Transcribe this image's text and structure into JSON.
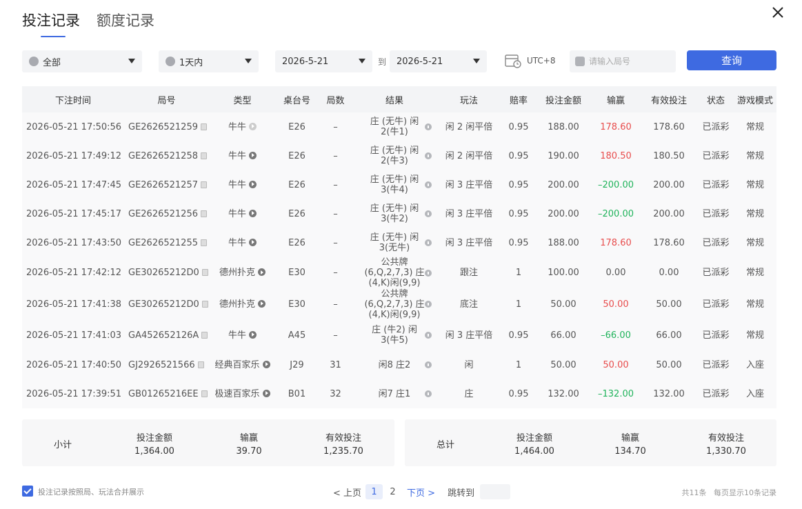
{
  "tabs": [
    {
      "label": "投注记录"
    },
    {
      "label": "额度记录"
    }
  ],
  "filters": {
    "category": "全部",
    "period": "1天内",
    "date_from": "2026-5-21",
    "to_label": "到",
    "date_to": "2026-5-21",
    "timezone": "UTC+8",
    "round_placeholder": "请输入局号",
    "query_label": "查询"
  },
  "table": {
    "headers": [
      "下注时间",
      "局号",
      "类型",
      "桌台号",
      "局数",
      "结果",
      "玩法",
      "赔率",
      "投注金额",
      "输赢",
      "有效投注",
      "状态",
      "游戏模式"
    ],
    "rows": [
      {
        "time": "2026-05-21 17:50:56",
        "round": "GE2626521259",
        "type": "牛牛",
        "table": "E26",
        "count": "–",
        "result": "庄 (无牛) 闲2(牛1)",
        "bet": "闲 2 闲平倍",
        "odds": "0.95",
        "amount": "188.00",
        "winloss": "178.60",
        "valid": "178.60",
        "status": "已派彩",
        "mode": "常规"
      },
      {
        "time": "2026-05-21 17:49:12",
        "round": "GE2626521258",
        "type": "牛牛",
        "table": "E26",
        "count": "–",
        "result": "庄 (无牛) 闲2(牛3)",
        "bet": "闲 2 闲平倍",
        "odds": "0.95",
        "amount": "190.00",
        "winloss": "180.50",
        "valid": "180.50",
        "status": "已派彩",
        "mode": "常规"
      },
      {
        "time": "2026-05-21 17:47:45",
        "round": "GE2626521257",
        "type": "牛牛",
        "table": "E26",
        "count": "–",
        "result": "庄 (无牛) 闲3(牛4)",
        "bet": "闲 3 庄平倍",
        "odds": "0.95",
        "amount": "200.00",
        "winloss": "–200.00",
        "valid": "200.00",
        "status": "已派彩",
        "mode": "常规"
      },
      {
        "time": "2026-05-21 17:45:17",
        "round": "GE2626521256",
        "type": "牛牛",
        "table": "E26",
        "count": "–",
        "result": "庄 (无牛) 闲3(牛2)",
        "bet": "闲 3 庄平倍",
        "odds": "0.95",
        "amount": "200.00",
        "winloss": "–200.00",
        "valid": "200.00",
        "status": "已派彩",
        "mode": "常规"
      },
      {
        "time": "2026-05-21 17:43:50",
        "round": "GE2626521255",
        "type": "牛牛",
        "table": "E26",
        "count": "–",
        "result": "庄 (无牛) 闲3(无牛)",
        "bet": "闲 3 庄平倍",
        "odds": "0.95",
        "amount": "188.00",
        "winloss": "178.60",
        "valid": "178.60",
        "status": "已派彩",
        "mode": "常规"
      },
      {
        "time": "2026-05-21 17:42:12",
        "round": "GE30265212D0",
        "type": "德州扑克",
        "table": "E30",
        "count": "–",
        "result": "公共牌 (6,Q,2,7,3) 庄(4,K)闲(9,9)",
        "bet": "跟注",
        "odds": "1",
        "amount": "100.00",
        "winloss": "0.00",
        "valid": "0.00",
        "status": "已派彩",
        "mode": "常规"
      },
      {
        "time": "2026-05-21 17:41:38",
        "round": "GE30265212D0",
        "type": "德州扑克",
        "table": "E30",
        "count": "–",
        "result": "公共牌 (6,Q,2,7,3) 庄(4,K)闲(9,9)",
        "bet": "底注",
        "odds": "1",
        "amount": "50.00",
        "winloss": "50.00",
        "valid": "50.00",
        "status": "已派彩",
        "mode": "常规"
      },
      {
        "time": "2026-05-21 17:41:03",
        "round": "GA452652126A",
        "type": "牛牛",
        "table": "A45",
        "count": "–",
        "result": "庄 (牛2) 闲3(牛5)",
        "bet": "闲 3 庄平倍",
        "odds": "0.95",
        "amount": "66.00",
        "winloss": "–66.00",
        "valid": "66.00",
        "status": "已派彩",
        "mode": "常规"
      },
      {
        "time": "2026-05-21 17:40:50",
        "round": "GJ2926521566",
        "type": "经典百家乐",
        "table": "J29",
        "count": "31",
        "result": "闲8 庄2",
        "bet": "闲",
        "odds": "1",
        "amount": "50.00",
        "winloss": "50.00",
        "valid": "50.00",
        "status": "已派彩",
        "mode": "入座"
      },
      {
        "time": "2026-05-21 17:39:51",
        "round": "GB01265216EE",
        "type": "极速百家乐",
        "table": "B01",
        "count": "32",
        "result": "闲7 庄1",
        "bet": "庄",
        "odds": "0.95",
        "amount": "132.00",
        "winloss": "–132.00",
        "valid": "132.00",
        "status": "已派彩",
        "mode": "入座"
      }
    ]
  },
  "subtotal": {
    "label": "小计",
    "amount_label": "投注金额",
    "amount": "1,364.00",
    "winloss_label": "输赢",
    "winloss": "39.70",
    "valid_label": "有效投注",
    "valid": "1,235.70"
  },
  "total": {
    "label": "总计",
    "amount_label": "投注金额",
    "amount": "1,464.00",
    "winloss_label": "输赢",
    "winloss": "134.70",
    "valid_label": "有效投注",
    "valid": "1,330.70"
  },
  "footer": {
    "merge_label": "投注记录按照局、玩法合并展示",
    "prev": "< 上页",
    "pages": [
      "1",
      "2"
    ],
    "current_page": "1",
    "next": "下页 >",
    "jump_label": "跳转到",
    "total_records": "共11条",
    "per_page": "每页显示10条记录"
  },
  "colors": {
    "accent": "#3e6ae1",
    "win": "#e84c4c",
    "loss": "#1fb35a"
  }
}
